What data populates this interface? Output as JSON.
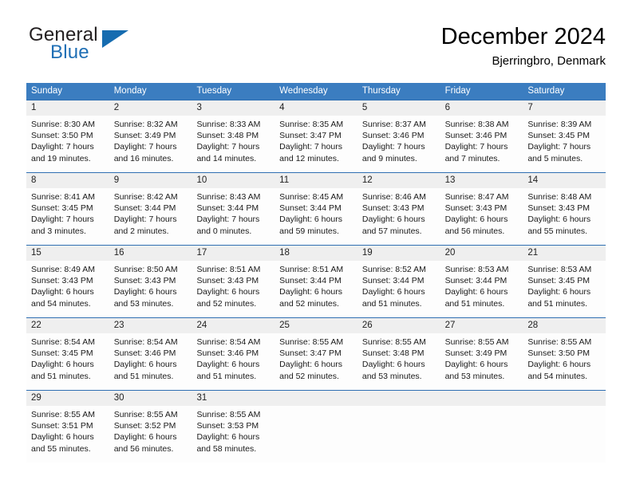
{
  "brand": {
    "name_part1": "General",
    "name_part2": "Blue",
    "triangle_color": "#166cb0",
    "blue_color": "#1f6fb5"
  },
  "header": {
    "title": "December 2024",
    "location": "Bjerringbro, Denmark"
  },
  "theme": {
    "header_blue": "#3b7dc0",
    "separator_blue": "#2f6fb2",
    "date_band_gray": "#efefef",
    "cell_white": "#fdfdfd"
  },
  "weekdays": [
    "Sunday",
    "Monday",
    "Tuesday",
    "Wednesday",
    "Thursday",
    "Friday",
    "Saturday"
  ],
  "weeks": [
    {
      "days": [
        {
          "date": "1",
          "sunrise": "Sunrise: 8:30 AM",
          "sunset": "Sunset: 3:50 PM",
          "daylight_line1": "Daylight: 7 hours",
          "daylight_line2": "and 19 minutes."
        },
        {
          "date": "2",
          "sunrise": "Sunrise: 8:32 AM",
          "sunset": "Sunset: 3:49 PM",
          "daylight_line1": "Daylight: 7 hours",
          "daylight_line2": "and 16 minutes."
        },
        {
          "date": "3",
          "sunrise": "Sunrise: 8:33 AM",
          "sunset": "Sunset: 3:48 PM",
          "daylight_line1": "Daylight: 7 hours",
          "daylight_line2": "and 14 minutes."
        },
        {
          "date": "4",
          "sunrise": "Sunrise: 8:35 AM",
          "sunset": "Sunset: 3:47 PM",
          "daylight_line1": "Daylight: 7 hours",
          "daylight_line2": "and 12 minutes."
        },
        {
          "date": "5",
          "sunrise": "Sunrise: 8:37 AM",
          "sunset": "Sunset: 3:46 PM",
          "daylight_line1": "Daylight: 7 hours",
          "daylight_line2": "and 9 minutes."
        },
        {
          "date": "6",
          "sunrise": "Sunrise: 8:38 AM",
          "sunset": "Sunset: 3:46 PM",
          "daylight_line1": "Daylight: 7 hours",
          "daylight_line2": "and 7 minutes."
        },
        {
          "date": "7",
          "sunrise": "Sunrise: 8:39 AM",
          "sunset": "Sunset: 3:45 PM",
          "daylight_line1": "Daylight: 7 hours",
          "daylight_line2": "and 5 minutes."
        }
      ]
    },
    {
      "days": [
        {
          "date": "8",
          "sunrise": "Sunrise: 8:41 AM",
          "sunset": "Sunset: 3:45 PM",
          "daylight_line1": "Daylight: 7 hours",
          "daylight_line2": "and 3 minutes."
        },
        {
          "date": "9",
          "sunrise": "Sunrise: 8:42 AM",
          "sunset": "Sunset: 3:44 PM",
          "daylight_line1": "Daylight: 7 hours",
          "daylight_line2": "and 2 minutes."
        },
        {
          "date": "10",
          "sunrise": "Sunrise: 8:43 AM",
          "sunset": "Sunset: 3:44 PM",
          "daylight_line1": "Daylight: 7 hours",
          "daylight_line2": "and 0 minutes."
        },
        {
          "date": "11",
          "sunrise": "Sunrise: 8:45 AM",
          "sunset": "Sunset: 3:44 PM",
          "daylight_line1": "Daylight: 6 hours",
          "daylight_line2": "and 59 minutes."
        },
        {
          "date": "12",
          "sunrise": "Sunrise: 8:46 AM",
          "sunset": "Sunset: 3:43 PM",
          "daylight_line1": "Daylight: 6 hours",
          "daylight_line2": "and 57 minutes."
        },
        {
          "date": "13",
          "sunrise": "Sunrise: 8:47 AM",
          "sunset": "Sunset: 3:43 PM",
          "daylight_line1": "Daylight: 6 hours",
          "daylight_line2": "and 56 minutes."
        },
        {
          "date": "14",
          "sunrise": "Sunrise: 8:48 AM",
          "sunset": "Sunset: 3:43 PM",
          "daylight_line1": "Daylight: 6 hours",
          "daylight_line2": "and 55 minutes."
        }
      ]
    },
    {
      "days": [
        {
          "date": "15",
          "sunrise": "Sunrise: 8:49 AM",
          "sunset": "Sunset: 3:43 PM",
          "daylight_line1": "Daylight: 6 hours",
          "daylight_line2": "and 54 minutes."
        },
        {
          "date": "16",
          "sunrise": "Sunrise: 8:50 AM",
          "sunset": "Sunset: 3:43 PM",
          "daylight_line1": "Daylight: 6 hours",
          "daylight_line2": "and 53 minutes."
        },
        {
          "date": "17",
          "sunrise": "Sunrise: 8:51 AM",
          "sunset": "Sunset: 3:43 PM",
          "daylight_line1": "Daylight: 6 hours",
          "daylight_line2": "and 52 minutes."
        },
        {
          "date": "18",
          "sunrise": "Sunrise: 8:51 AM",
          "sunset": "Sunset: 3:44 PM",
          "daylight_line1": "Daylight: 6 hours",
          "daylight_line2": "and 52 minutes."
        },
        {
          "date": "19",
          "sunrise": "Sunrise: 8:52 AM",
          "sunset": "Sunset: 3:44 PM",
          "daylight_line1": "Daylight: 6 hours",
          "daylight_line2": "and 51 minutes."
        },
        {
          "date": "20",
          "sunrise": "Sunrise: 8:53 AM",
          "sunset": "Sunset: 3:44 PM",
          "daylight_line1": "Daylight: 6 hours",
          "daylight_line2": "and 51 minutes."
        },
        {
          "date": "21",
          "sunrise": "Sunrise: 8:53 AM",
          "sunset": "Sunset: 3:45 PM",
          "daylight_line1": "Daylight: 6 hours",
          "daylight_line2": "and 51 minutes."
        }
      ]
    },
    {
      "days": [
        {
          "date": "22",
          "sunrise": "Sunrise: 8:54 AM",
          "sunset": "Sunset: 3:45 PM",
          "daylight_line1": "Daylight: 6 hours",
          "daylight_line2": "and 51 minutes."
        },
        {
          "date": "23",
          "sunrise": "Sunrise: 8:54 AM",
          "sunset": "Sunset: 3:46 PM",
          "daylight_line1": "Daylight: 6 hours",
          "daylight_line2": "and 51 minutes."
        },
        {
          "date": "24",
          "sunrise": "Sunrise: 8:54 AM",
          "sunset": "Sunset: 3:46 PM",
          "daylight_line1": "Daylight: 6 hours",
          "daylight_line2": "and 51 minutes."
        },
        {
          "date": "25",
          "sunrise": "Sunrise: 8:55 AM",
          "sunset": "Sunset: 3:47 PM",
          "daylight_line1": "Daylight: 6 hours",
          "daylight_line2": "and 52 minutes."
        },
        {
          "date": "26",
          "sunrise": "Sunrise: 8:55 AM",
          "sunset": "Sunset: 3:48 PM",
          "daylight_line1": "Daylight: 6 hours",
          "daylight_line2": "and 53 minutes."
        },
        {
          "date": "27",
          "sunrise": "Sunrise: 8:55 AM",
          "sunset": "Sunset: 3:49 PM",
          "daylight_line1": "Daylight: 6 hours",
          "daylight_line2": "and 53 minutes."
        },
        {
          "date": "28",
          "sunrise": "Sunrise: 8:55 AM",
          "sunset": "Sunset: 3:50 PM",
          "daylight_line1": "Daylight: 6 hours",
          "daylight_line2": "and 54 minutes."
        }
      ]
    },
    {
      "days": [
        {
          "date": "29",
          "sunrise": "Sunrise: 8:55 AM",
          "sunset": "Sunset: 3:51 PM",
          "daylight_line1": "Daylight: 6 hours",
          "daylight_line2": "and 55 minutes."
        },
        {
          "date": "30",
          "sunrise": "Sunrise: 8:55 AM",
          "sunset": "Sunset: 3:52 PM",
          "daylight_line1": "Daylight: 6 hours",
          "daylight_line2": "and 56 minutes."
        },
        {
          "date": "31",
          "sunrise": "Sunrise: 8:55 AM",
          "sunset": "Sunset: 3:53 PM",
          "daylight_line1": "Daylight: 6 hours",
          "daylight_line2": "and 58 minutes."
        },
        {
          "date": "",
          "sunrise": "",
          "sunset": "",
          "daylight_line1": "",
          "daylight_line2": ""
        },
        {
          "date": "",
          "sunrise": "",
          "sunset": "",
          "daylight_line1": "",
          "daylight_line2": ""
        },
        {
          "date": "",
          "sunrise": "",
          "sunset": "",
          "daylight_line1": "",
          "daylight_line2": ""
        },
        {
          "date": "",
          "sunrise": "",
          "sunset": "",
          "daylight_line1": "",
          "daylight_line2": ""
        }
      ]
    }
  ]
}
